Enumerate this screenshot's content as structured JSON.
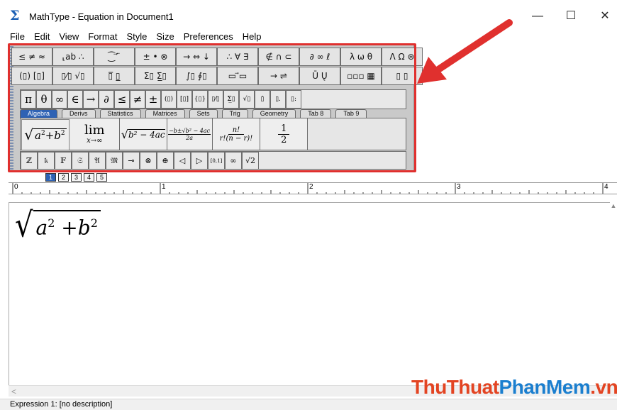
{
  "window": {
    "title": "MathType - Equation in Document1",
    "app_icon": "Σ",
    "controls": {
      "minimize": "—",
      "maximize": "☐",
      "close": "✕"
    }
  },
  "menu": [
    "File",
    "Edit",
    "View",
    "Format",
    "Style",
    "Size",
    "Preferences",
    "Help"
  ],
  "palette_row1": [
    "≤ ≠ ≈",
    "⸤ab ∴",
    "⁐ ⃗ ̈",
    "± • ⊗",
    "→ ⇔ ↓",
    "∴ ∀ ∃",
    "∉ ∩ ⊂",
    "∂ ∞ ℓ",
    "λ ω θ",
    "Λ Ω ⊛"
  ],
  "palette_row2": [
    "(▯) [▯]",
    "▯⁄▯ √▯",
    "▯̅ ▯̲",
    "Σ▯ Σ̲▯",
    "∫▯ ∮▯",
    "▭ ⃗▭",
    "→ ⇌",
    "Ū Ų",
    "▫▫▫ ▦",
    "▯ ▯"
  ],
  "symbol_bar": [
    "π",
    "θ",
    "∞",
    "∈",
    "→",
    "∂",
    "≤",
    "≠",
    "±",
    "(▯)",
    "[▯]",
    "{▯}",
    "▯⁄▯",
    "Σ̲▯",
    "√▯",
    "▯̇",
    "▯.",
    "▯:"
  ],
  "tabs": [
    {
      "label": "Algebra",
      "active": true
    },
    {
      "label": "Derivs",
      "active": false
    },
    {
      "label": "Statistics",
      "active": false
    },
    {
      "label": "Matrices",
      "active": false
    },
    {
      "label": "Sets",
      "active": false
    },
    {
      "label": "Trig",
      "active": false
    },
    {
      "label": "Geometry",
      "active": false
    },
    {
      "label": "Tab 8",
      "active": false
    },
    {
      "label": "Tab 9",
      "active": false
    }
  ],
  "templates": {
    "pythag_a": "a",
    "pythag_sup1": "2",
    "pythag_plus": "+",
    "pythag_b": "b",
    "pythag_sup2": "2",
    "lim": "lim",
    "lim_sub": "x→∞",
    "discriminant": "b² − 4ac",
    "quadratic_num": "−b±√b² − 4ac",
    "quadratic_den": "2a",
    "comb_num": "n!",
    "comb_den": "r!(n − r)!",
    "half_num": "1",
    "half_den": "2"
  },
  "bottom_symbols": [
    "ℤ",
    "𝔨",
    "𝔽",
    "𝔖",
    "𝔄",
    "𝔐",
    "⊸",
    "⊗",
    "⊕",
    "◁",
    "▷",
    "[0,1]",
    "∞",
    "√2"
  ],
  "size_tabs": [
    {
      "label": "1",
      "active": true
    },
    {
      "label": "2",
      "active": false
    },
    {
      "label": "3",
      "active": false
    },
    {
      "label": "4",
      "active": false
    },
    {
      "label": "5",
      "active": false
    }
  ],
  "ruler_numbers": [
    "0",
    "1",
    "2",
    "3",
    "4"
  ],
  "equation": {
    "radicand_a": "a",
    "exp_a": "2",
    "plus": "+",
    "radicand_b": "b",
    "exp_b": "2"
  },
  "status": "Expression 1: [no description]",
  "watermark": {
    "part1": "ThuThuat",
    "part2": "PhanMem",
    "part3": ".vn"
  },
  "accent_colors": {
    "highlight": "#e0302e",
    "active_tab": "#2e62b4",
    "watermark_red": "#e34422",
    "watermark_blue": "#1b7fcf"
  }
}
